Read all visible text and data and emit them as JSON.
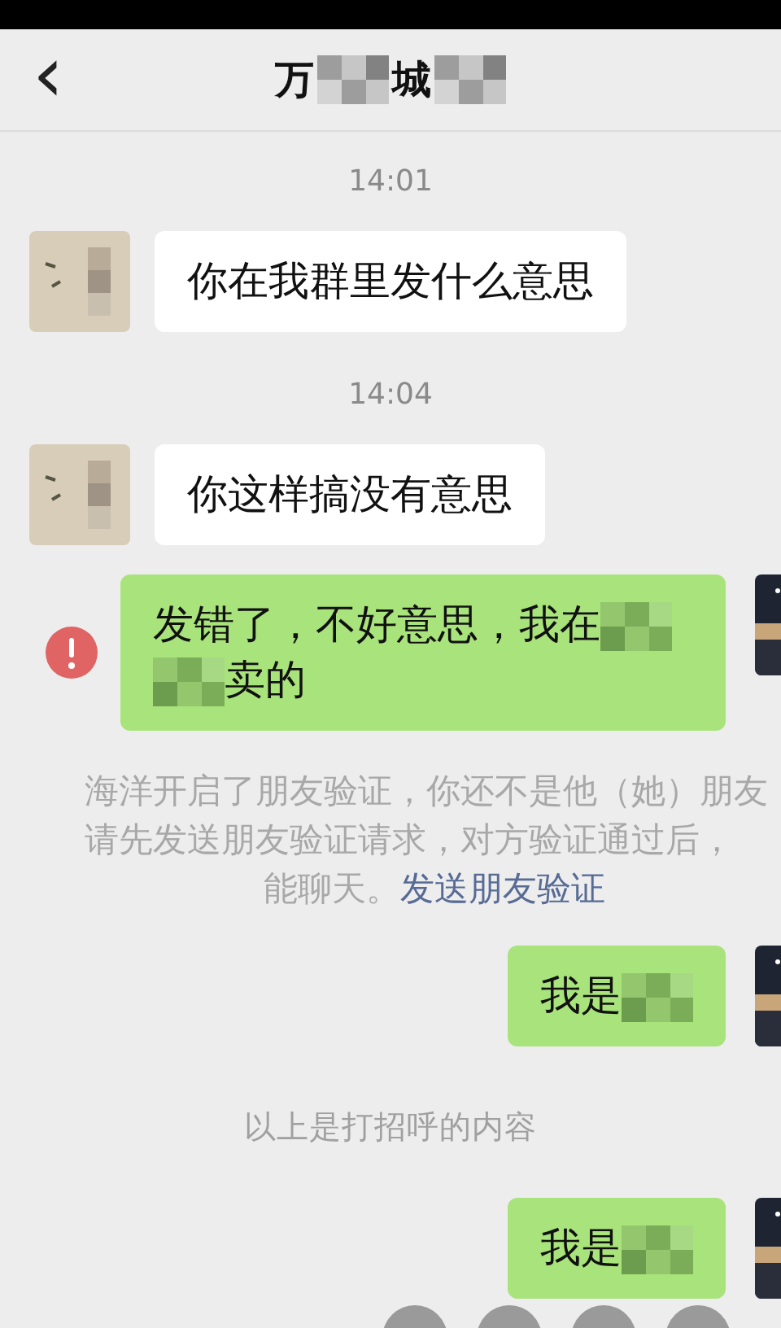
{
  "header": {
    "back": "‹",
    "title_parts": [
      {
        "kind": "text",
        "text": "万"
      },
      {
        "kind": "blur"
      },
      {
        "kind": "text",
        "text": "城"
      },
      {
        "kind": "blur"
      }
    ]
  },
  "messages": [
    {
      "kind": "time",
      "text": "14:01"
    },
    {
      "kind": "incoming",
      "parts": [
        {
          "kind": "text",
          "text": "你在我群里发什么意思"
        }
      ]
    },
    {
      "kind": "time",
      "text": "14:04"
    },
    {
      "kind": "incoming",
      "parts": [
        {
          "kind": "text",
          "text": "你这样搞没有意思"
        }
      ]
    },
    {
      "kind": "outgoing",
      "failed": true,
      "parts": [
        {
          "kind": "text",
          "text": "发错了，不好意思，我在"
        },
        {
          "kind": "blur"
        },
        {
          "kind": "blur"
        },
        {
          "kind": "text",
          "text": "卖的"
        }
      ]
    },
    {
      "kind": "system",
      "lines": [
        "海洋开启了朋友验证，你还不是他（她）朋友",
        "请先发送朋友验证请求，对方验证通过后，"
      ],
      "last": "能聊天。",
      "link": "发送朋友验证"
    },
    {
      "kind": "outgoing",
      "failed": false,
      "parts": [
        {
          "kind": "text",
          "text": "我是"
        },
        {
          "kind": "blur"
        }
      ]
    },
    {
      "kind": "notice",
      "text": "以上是打招呼的内容"
    },
    {
      "kind": "outgoing",
      "failed": false,
      "parts": [
        {
          "kind": "text",
          "text": "我是"
        },
        {
          "kind": "blur"
        }
      ]
    }
  ],
  "bottom_actions": [
    {
      "kind": "round"
    },
    {
      "kind": "round"
    },
    {
      "kind": "round"
    },
    {
      "kind": "round"
    }
  ]
}
